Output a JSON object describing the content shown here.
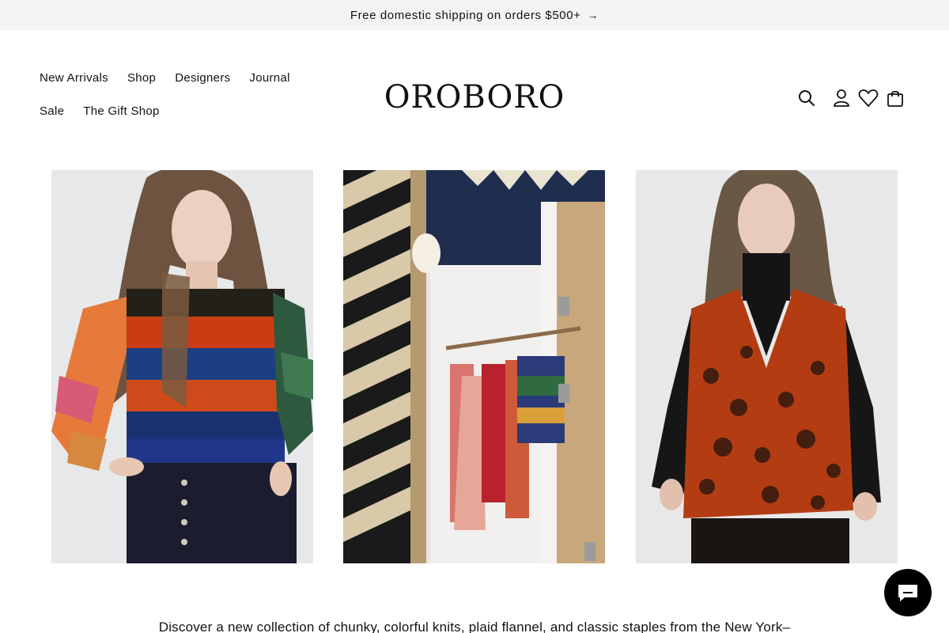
{
  "announcement": {
    "text": "Free domestic shipping on orders $500+",
    "arrow": "→"
  },
  "header": {
    "logo": "OROBORO",
    "nav": [
      {
        "label": "New Arrivals"
      },
      {
        "label": "Shop"
      },
      {
        "label": "Designers"
      },
      {
        "label": "Journal"
      },
      {
        "label": "Sale"
      },
      {
        "label": "The Gift Shop"
      }
    ],
    "icons": [
      "search-icon",
      "account-icon",
      "wishlist-heart-icon",
      "cart-bag-icon"
    ]
  },
  "gallery": {
    "images": [
      {
        "name": "model-striped-sweater-image"
      },
      {
        "name": "boutique-fitting-room-image"
      },
      {
        "name": "model-orange-vest-image"
      }
    ]
  },
  "intro": {
    "text": "Discover a new collection of chunky, colorful knits, plaid flannel, and classic staples from the New York–"
  },
  "chat": {
    "icon": "chat-bubble-icon",
    "color": "#000000"
  },
  "colors": {
    "announcement_bg": "#f3f3f3",
    "text": "#121212"
  }
}
